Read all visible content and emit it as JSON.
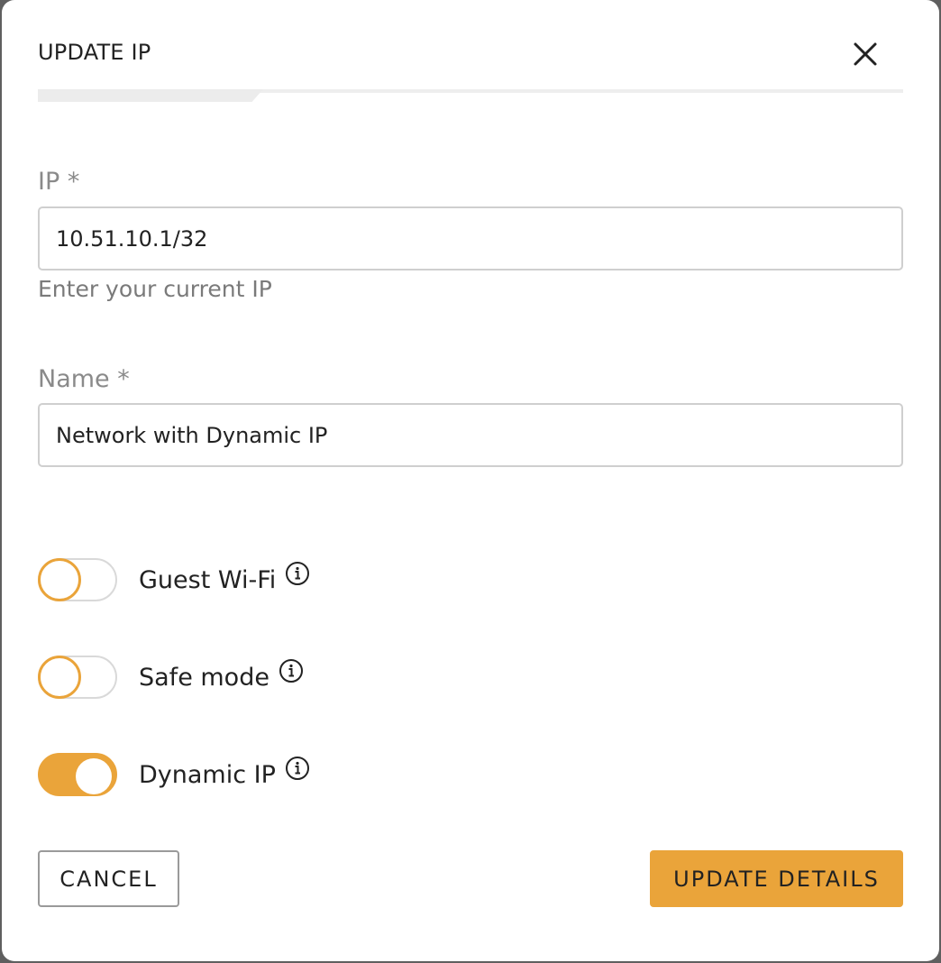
{
  "dialog": {
    "title": "UPDATE IP",
    "close_icon": "close-icon"
  },
  "fields": {
    "ip": {
      "label": "IP *",
      "value": "10.51.10.1/32",
      "helper": "Enter your current IP"
    },
    "name": {
      "label": "Name *",
      "value": "Network with Dynamic IP"
    }
  },
  "toggles": {
    "guest_wifi": {
      "label": "Guest Wi-Fi",
      "checked": false
    },
    "safe_mode": {
      "label": "Safe mode",
      "checked": false
    },
    "dynamic_ip": {
      "label": "Dynamic IP",
      "checked": true
    }
  },
  "actions": {
    "cancel_label": "CANCEL",
    "submit_label": "UPDATE DETAILS"
  },
  "colors": {
    "accent": "#eaa43a",
    "text": "#222222",
    "muted": "#8a8a8a"
  },
  "progress": {
    "fraction": 0.26
  }
}
